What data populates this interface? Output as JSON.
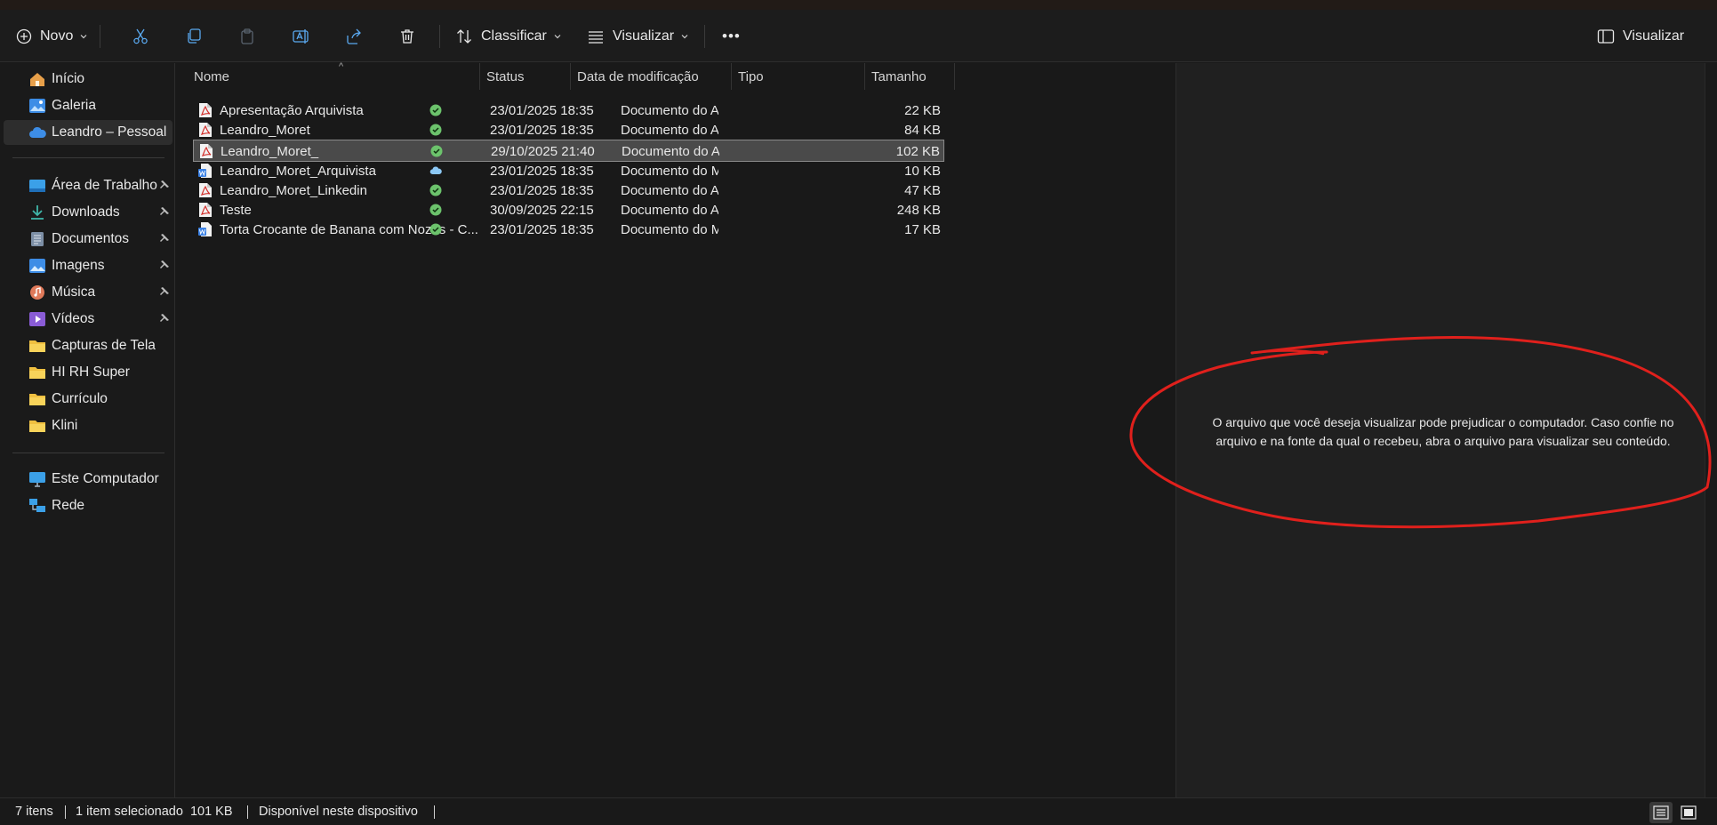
{
  "toolbar": {
    "new_label": "Novo",
    "sort_label": "Classificar",
    "view_label": "Visualizar",
    "more_label": "•••",
    "preview_toggle_label": "Visualizar"
  },
  "sidebar": {
    "items": [
      {
        "label": "Início",
        "icon": "home-icon",
        "pinned": false
      },
      {
        "label": "Galeria",
        "icon": "gallery-icon",
        "pinned": false
      },
      {
        "label": "Leandro – Pessoal",
        "icon": "onedrive-cloud-icon",
        "pinned": false,
        "selected": true
      },
      {
        "label": "Área de Trabalho",
        "icon": "desktop-icon",
        "pinned": true
      },
      {
        "label": "Downloads",
        "icon": "downloads-icon",
        "pinned": true
      },
      {
        "label": "Documentos",
        "icon": "documents-icon",
        "pinned": true
      },
      {
        "label": "Imagens",
        "icon": "pictures-icon",
        "pinned": true
      },
      {
        "label": "Música",
        "icon": "music-icon",
        "pinned": true
      },
      {
        "label": "Vídeos",
        "icon": "videos-icon",
        "pinned": true
      },
      {
        "label": "Capturas de Tela",
        "icon": "folder-icon",
        "pinned": false
      },
      {
        "label": "HI RH Super",
        "icon": "folder-icon",
        "pinned": false
      },
      {
        "label": "Currículo",
        "icon": "folder-icon",
        "pinned": false
      },
      {
        "label": "Klini",
        "icon": "folder-icon",
        "pinned": false
      },
      {
        "label": "Este Computador",
        "icon": "computer-icon",
        "pinned": false
      },
      {
        "label": "Rede",
        "icon": "network-icon",
        "pinned": false
      }
    ]
  },
  "columns": {
    "name": "Nome",
    "status": "Status",
    "modified": "Data de modificação",
    "type": "Tipo",
    "size": "Tamanho"
  },
  "files": [
    {
      "name": "Apresentação Arquivista",
      "icon": "pdf-icon",
      "status": "synced",
      "modified": "23/01/2025 18:35",
      "type": "Documento do Ad...",
      "size": "22 KB"
    },
    {
      "name": "Leandro_Moret",
      "icon": "pdf-icon",
      "status": "synced",
      "modified": "23/01/2025 18:35",
      "type": "Documento do Ad...",
      "size": "84 KB"
    },
    {
      "name": "Leandro_Moret_",
      "icon": "pdf-icon",
      "status": "synced",
      "modified": "29/10/2025 21:40",
      "type": "Documento do Ad...",
      "size": "102 KB",
      "selected": true
    },
    {
      "name": "Leandro_Moret_Arquivista",
      "icon": "word-icon",
      "status": "cloud",
      "modified": "23/01/2025 18:35",
      "type": "Documento do Mi...",
      "size": "10 KB"
    },
    {
      "name": "Leandro_Moret_Linkedin",
      "icon": "pdf-icon",
      "status": "synced",
      "modified": "23/01/2025 18:35",
      "type": "Documento do Ad...",
      "size": "47 KB"
    },
    {
      "name": "Teste",
      "icon": "pdf-icon",
      "status": "synced",
      "modified": "30/09/2025 22:15",
      "type": "Documento do Ad...",
      "size": "248 KB"
    },
    {
      "name": "Torta Crocante de Banana com Nozes - C...",
      "icon": "word-icon",
      "status": "synced",
      "modified": "23/01/2025 18:35",
      "type": "Documento do Mi...",
      "size": "17 KB"
    }
  ],
  "preview": {
    "message": "O arquivo que você deseja visualizar pode prejudicar o computador. Caso confie no arquivo e na fonte da qual o recebeu, abra o arquivo para visualizar seu conteúdo."
  },
  "statusbar": {
    "item_count": "7 itens",
    "selection": "1 item selecionado  101 KB",
    "availability": "Disponível neste dispositivo"
  },
  "colors": {
    "background": "#191919",
    "preview_background": "#202020",
    "selected_row": "#4a4a4a",
    "annotation_red": "#e0201c",
    "status_green": "#6cc36c",
    "pdf_red": "#d2302c",
    "word_blue": "#3b82e6"
  }
}
